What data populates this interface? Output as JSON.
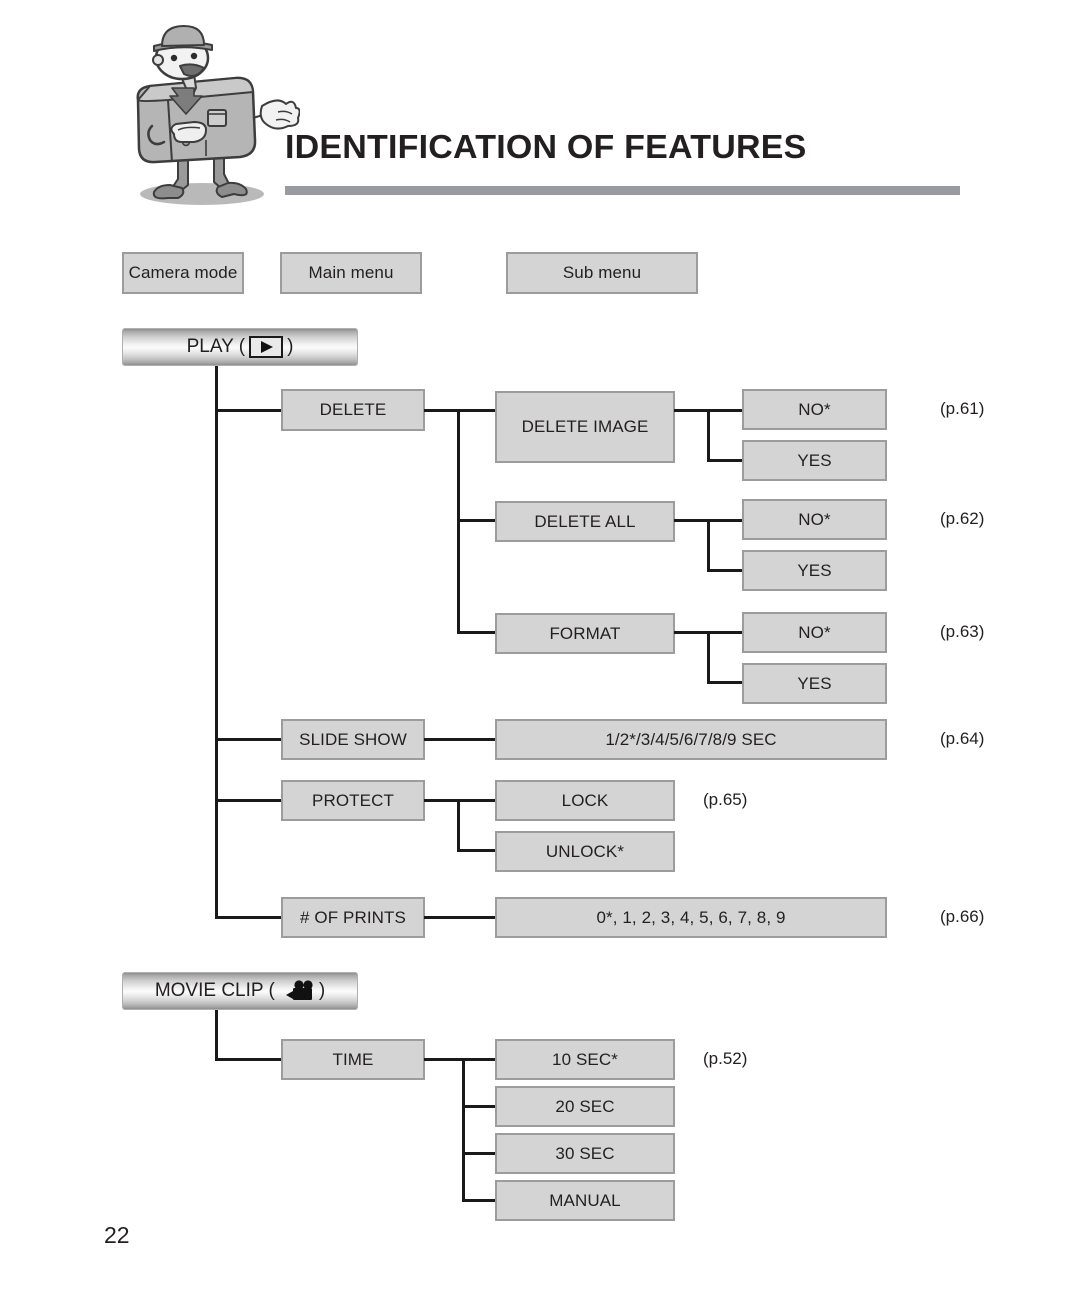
{
  "header": {
    "title": "IDENTIFICATION OF FEATURES",
    "mascot_icon": "camera-mascot-icon"
  },
  "column_headers": [
    {
      "label": "Camera mode"
    },
    {
      "label": "Main menu"
    },
    {
      "label": "Sub menu"
    }
  ],
  "modes": [
    {
      "label": "PLAY (",
      "close": ")",
      "icon": "play-icon"
    },
    {
      "label": "MOVIE CLIP (",
      "close": ")",
      "icon": "movie-camera-icon"
    }
  ],
  "play_menu": {
    "delete": {
      "label": "DELETE",
      "items": [
        {
          "label": "DELETE IMAGE",
          "options": [
            "NO*",
            "YES"
          ],
          "page": "(p.61)"
        },
        {
          "label": "DELETE ALL",
          "options": [
            "NO*",
            "YES"
          ],
          "page": "(p.62)"
        },
        {
          "label": "FORMAT",
          "options": [
            "NO*",
            "YES"
          ],
          "page": "(p.63)"
        }
      ]
    },
    "slide_show": {
      "label": "SLIDE SHOW",
      "value": "1/2*/3/4/5/6/7/8/9 SEC",
      "page": "(p.64)"
    },
    "protect": {
      "label": "PROTECT",
      "options": [
        "LOCK",
        "UNLOCK*"
      ],
      "page": "(p.65)"
    },
    "prints": {
      "label": "# OF PRINTS",
      "value": "0*, 1, 2, 3, 4, 5, 6, 7, 8, 9",
      "page": "(p.66)"
    }
  },
  "movie_menu": {
    "time": {
      "label": "TIME",
      "options": [
        "10 SEC*",
        "20 SEC",
        "30 SEC",
        "MANUAL"
      ],
      "page": "(p.52)"
    }
  },
  "footer": {
    "page_number": "22"
  },
  "colors": {
    "box_fill": "#d4d4d4",
    "box_border": "#9c9c9c",
    "line": "#1a1a1a",
    "rule": "#9a9ba0",
    "text": "#231f20"
  }
}
